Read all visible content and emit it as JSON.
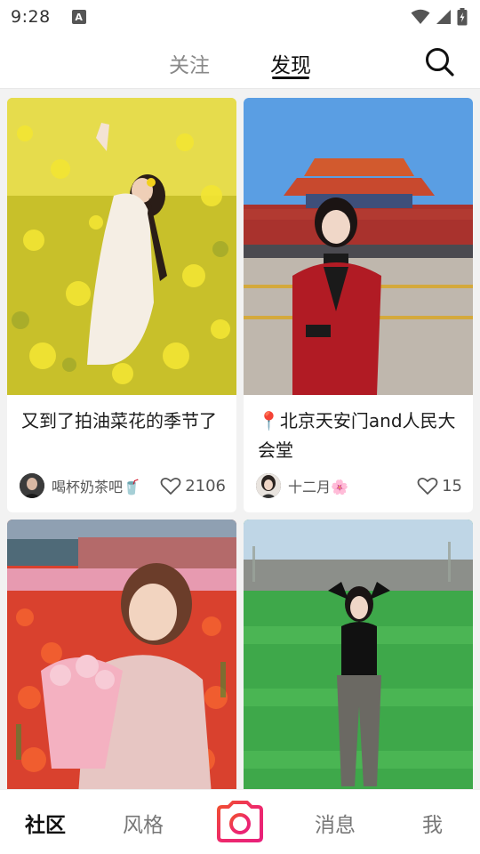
{
  "status_bar": {
    "time": "9:28",
    "notification_icon": "a-letter-icon",
    "icons": [
      "wifi-icon",
      "signal-icon",
      "battery-icon"
    ]
  },
  "header": {
    "tabs": [
      {
        "label": "关注",
        "active": false
      },
      {
        "label": "发现",
        "active": true
      }
    ],
    "search_icon": "search-icon"
  },
  "feed": {
    "cards": [
      {
        "image": "rapeseed-flower-field-photo",
        "title": "又到了拍油菜花的季节了",
        "author": "喝杯奶茶吧🥤",
        "likes": "2106"
      },
      {
        "image": "tiananmen-gate-photo",
        "title": "📍北京天安门and人民大会堂",
        "author": "十二月🌸",
        "likes": "15"
      },
      {
        "image": "tulip-field-photo",
        "title": "",
        "author": "",
        "likes": ""
      },
      {
        "image": "football-field-photo",
        "title": "",
        "author": "",
        "likes": ""
      }
    ]
  },
  "bottom_nav": {
    "items": [
      {
        "label": "社区",
        "active": true
      },
      {
        "label": "风格",
        "active": false
      },
      {
        "label": "",
        "icon": "camera-icon"
      },
      {
        "label": "消息",
        "active": false
      },
      {
        "label": "我",
        "active": false
      }
    ],
    "accent": "#ee2a6a"
  }
}
